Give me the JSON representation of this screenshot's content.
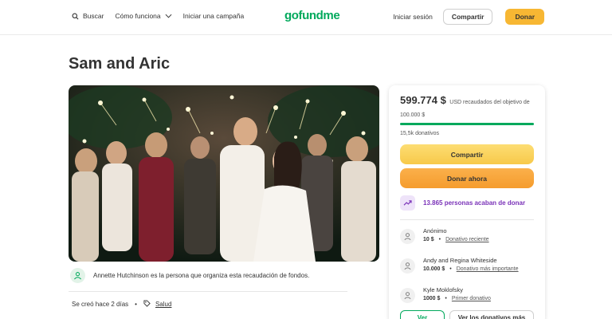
{
  "header": {
    "search_label": "Buscar",
    "how_it_works_label": "Cómo funciona",
    "start_campaign_label": "Iniciar una campaña",
    "logo_text": "gofundme",
    "signin_label": "Iniciar sesión",
    "share_label": "Compartir",
    "donate_label": "Donar"
  },
  "campaign": {
    "title": "Sam and Aric",
    "organizer_text": "Annette Hutchinson es la persona que organiza esta recaudación de fondos.",
    "created_text": "Se creó hace 2 días",
    "category": "Salud"
  },
  "sidebar": {
    "raised_amount": "599.774 $",
    "goal_text": "USD recaudados del objetivo de 100.000 $",
    "progress_fraction": 1.0,
    "donations_count": "15,5k donativos",
    "share_button": "Compartir",
    "donate_button": "Donar ahora",
    "recent_donors_text": "13.865 personas acaban de donar",
    "donations": [
      {
        "name": "Anónimo",
        "amount": "10 $",
        "tag": "Donativo reciente"
      },
      {
        "name": "Andy and Regina Whiteside",
        "amount": "10.000 $",
        "tag": "Donativo más importante"
      },
      {
        "name": "Kyle Moklofsky",
        "amount": "1000 $",
        "tag": "Primer donativo"
      }
    ],
    "see_all_button": "Ver",
    "see_top_button": "Ver los donativos más"
  },
  "colors": {
    "brand_green": "#02a95c",
    "donate_yellow": "#f7b733",
    "donate_orange": "#f59c2d",
    "recent_purple": "#7a32b8"
  },
  "icons": {
    "search": "search-icon",
    "chevron": "chevron-down-icon",
    "organizer": "organizer-icon",
    "tag": "tag-icon",
    "trend": "trend-icon",
    "donor": "donor-icon"
  }
}
